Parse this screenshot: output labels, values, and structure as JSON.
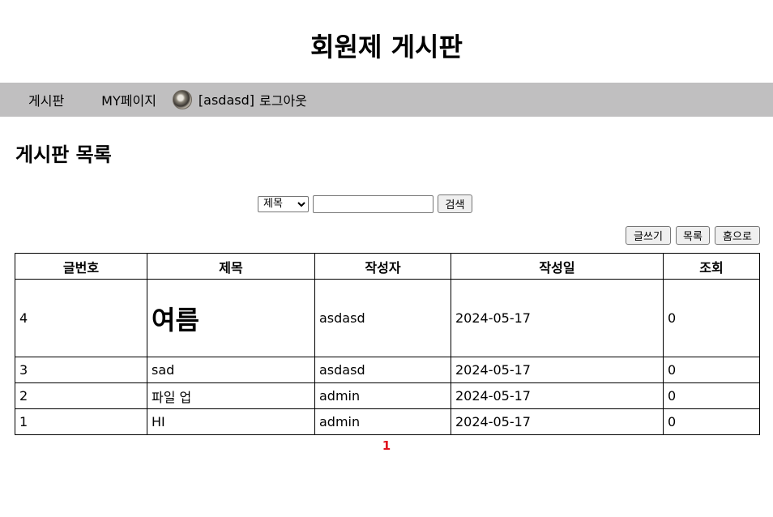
{
  "site": {
    "title": "회원제 게시판"
  },
  "nav": {
    "board": "게시판",
    "mypage": "MY페이지",
    "user": "[asdasd]",
    "logout": "로그아웃"
  },
  "section_title": "게시판 목록",
  "search": {
    "selected": "제목",
    "value": "",
    "button": "검색"
  },
  "actions": {
    "write": "글쓰기",
    "list": "목록",
    "home": "홈으로"
  },
  "table": {
    "headers": [
      "글번호",
      "제목",
      "작성자",
      "작성일",
      "조회"
    ],
    "rows": [
      {
        "no": "4",
        "title": "여름",
        "writer": "asdasd",
        "date": "2024-05-17",
        "views": "0"
      },
      {
        "no": "3",
        "title": "sad",
        "writer": "asdasd",
        "date": "2024-05-17",
        "views": "0"
      },
      {
        "no": "2",
        "title": "파일 업",
        "writer": "admin",
        "date": "2024-05-17",
        "views": "0"
      },
      {
        "no": "1",
        "title": "HI",
        "writer": "admin",
        "date": "2024-05-17",
        "views": "0"
      }
    ]
  },
  "pagination": {
    "current": "1"
  },
  "colors": {
    "nav_bg": "#c0bfc0",
    "pager_active": "#e0141e"
  },
  "icons": {
    "avatar": "user-avatar-photo"
  }
}
